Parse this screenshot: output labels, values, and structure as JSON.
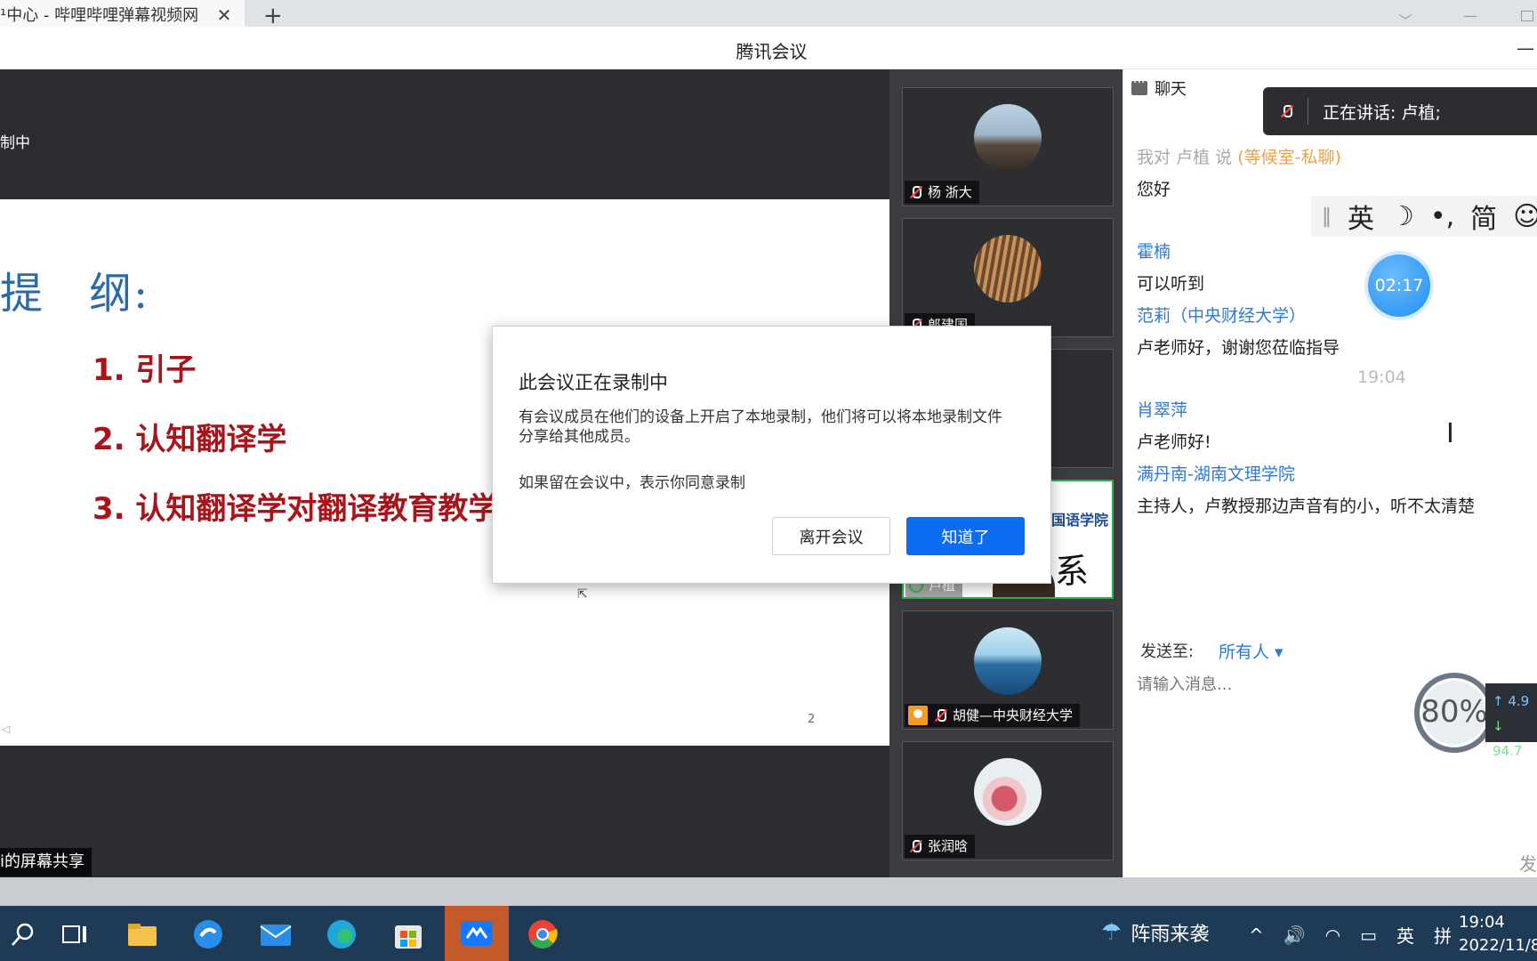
{
  "browser": {
    "tab_title": "¹中心 - 哔哩哔哩弹幕视频网",
    "tab_close": "✕",
    "new_tab": "+"
  },
  "window": {
    "title": "腾讯会议",
    "minimize": "—"
  },
  "share": {
    "recording_label": "制中",
    "share_tag": "i的屏幕共享",
    "slide": {
      "title": "提　纲:",
      "items": [
        "1. 引子",
        "2. 认知翻译学",
        "3. 认知翻译学对翻译教育教学"
      ],
      "page_number": "2"
    }
  },
  "participants": [
    {
      "name": "杨 浙大",
      "muted": true
    },
    {
      "name": "郎建国",
      "muted": true
    },
    {
      "name": "",
      "muted": false
    },
    {
      "name": "卢植",
      "muted": false,
      "speaking": true,
      "banner_text": "国语学院",
      "banner_text2": "系列"
    },
    {
      "name": "胡健—中央财经大学",
      "muted": true,
      "host": true
    },
    {
      "name": "张润晗",
      "muted": true
    }
  ],
  "chat": {
    "header": "聊天",
    "speaking_banner": "正在讲话: 卢植;",
    "messages": [
      {
        "type": "private",
        "prefix": "我对",
        "to": "卢植",
        "verb": "说",
        "tag": "(等候室-私聊)",
        "body": "您好"
      },
      {
        "sender": "霍楠",
        "body": "可以听到"
      },
      {
        "sender": "范莉（中央财经大学）",
        "body": "卢老师好，谢谢您莅临指导"
      },
      {
        "time": "19:04"
      },
      {
        "sender": "肖翠萍",
        "body": "卢老师好!"
      },
      {
        "sender": "满丹南-湖南文理学院",
        "body": "主持人，卢教授那边声音有的小，听不太清楚"
      }
    ],
    "send_to_label": "发送至:",
    "send_to_target": "所有人 ▾",
    "input_placeholder": "请输入消息...",
    "send_label": "发"
  },
  "ime": {
    "items": [
      "英",
      "☽",
      "•,",
      "简",
      "☺"
    ]
  },
  "timer": "02:17",
  "network": {
    "percent": "80%",
    "up": "↑ 4.9",
    "down": "↓ 94.7"
  },
  "dialog": {
    "title": "此会议正在录制中",
    "body": "有会议成员在他们的设备上开启了本地录制，他们将可以将本地录制文件分享给其他成员。",
    "body2": "如果留在会议中，表示你同意录制",
    "leave_label": "离开会议",
    "ok_label": "知道了"
  },
  "taskbar": {
    "weather": "阵雨来袭",
    "tray": [
      "^",
      "🔊",
      "英",
      "拼"
    ],
    "time": "19:04",
    "date": "2022/11/8"
  }
}
